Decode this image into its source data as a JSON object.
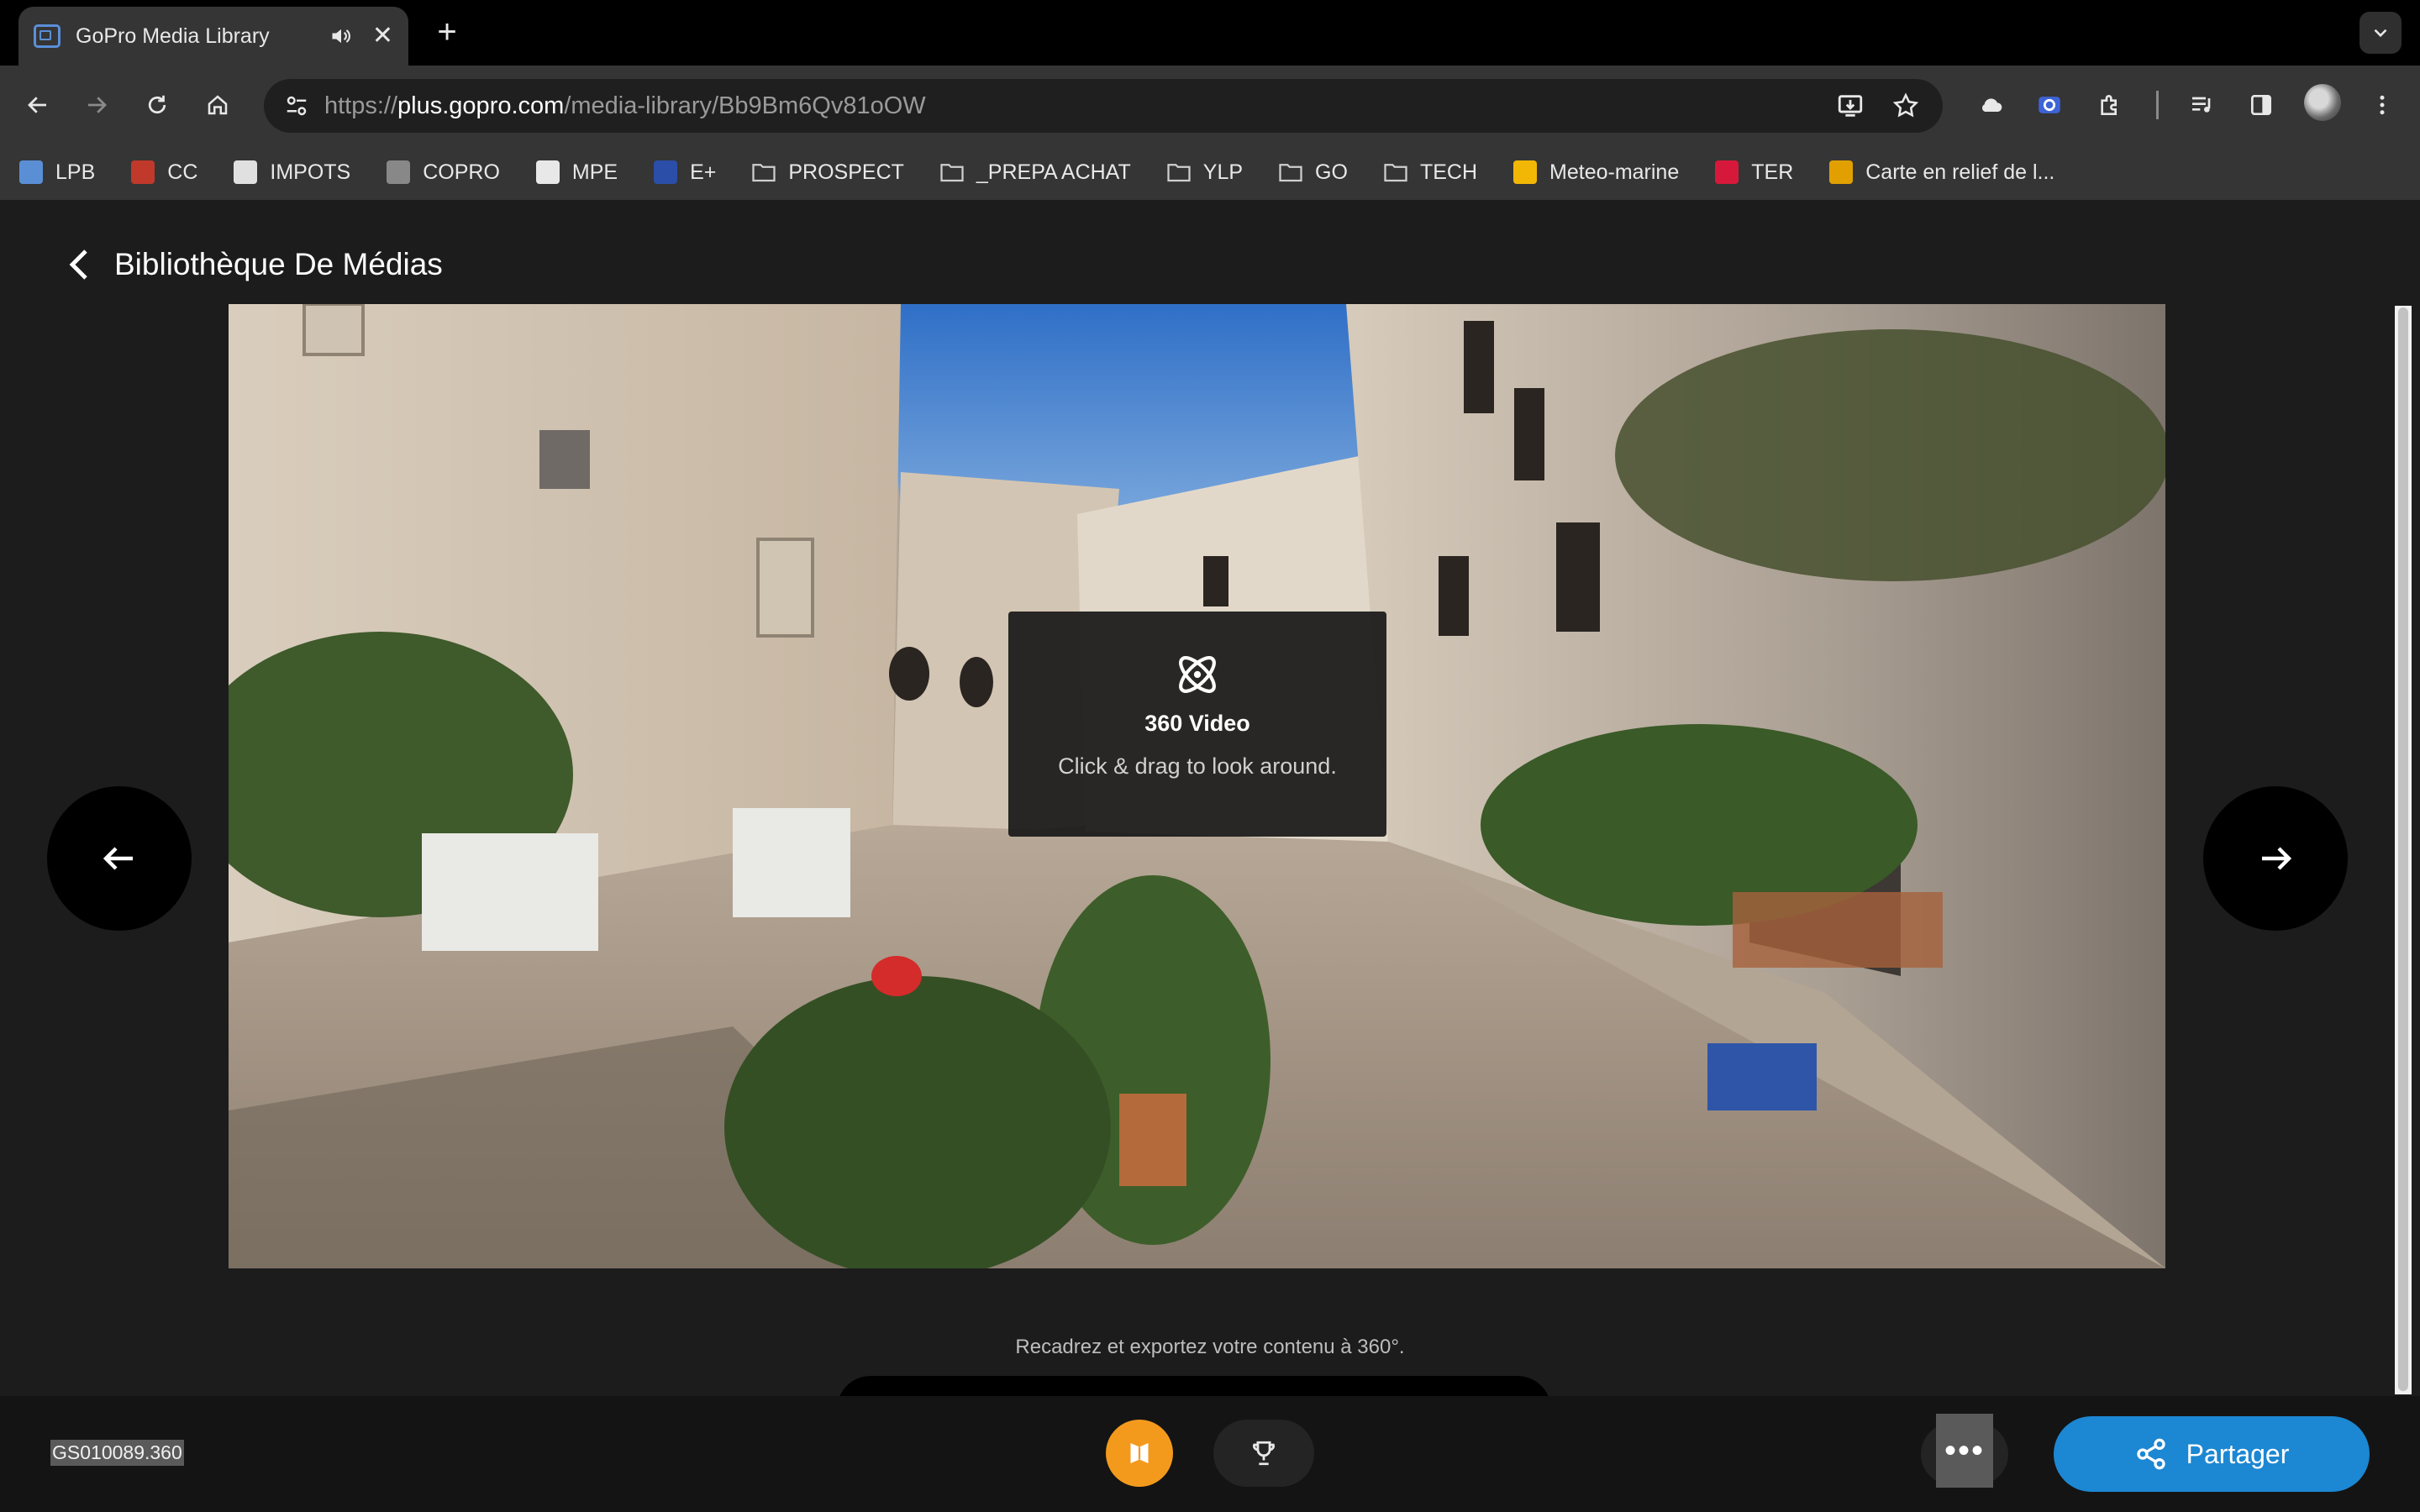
{
  "browser": {
    "tab_title": "GoPro Media Library",
    "tab_close": "✕",
    "new_tab": "+",
    "url_prefix": "https://",
    "url_host": "plus.gopro.com",
    "url_path": "/media-library/Bb9Bm6Qv81oOW"
  },
  "bookmarks": [
    {
      "label": "LPB",
      "icon": "lpb-icon",
      "color": "#5a8fd6"
    },
    {
      "label": "CC",
      "icon": "cc-icon",
      "color": "#c0392b"
    },
    {
      "label": "IMPOTS",
      "icon": "impots-icon",
      "color": "#e0e0e0"
    },
    {
      "label": "COPRO",
      "icon": "copro-icon",
      "color": "#888888"
    },
    {
      "label": "MPE",
      "icon": "mpe-icon",
      "color": "#e8e8e8"
    },
    {
      "label": "E+",
      "icon": "eu-icon",
      "color": "#2b4ea8"
    },
    {
      "label": "PROSPECT",
      "icon": "folder-icon",
      "color": "#cfcfcf"
    },
    {
      "label": "_PREPA ACHAT",
      "icon": "folder-icon",
      "color": "#cfcfcf"
    },
    {
      "label": "YLP",
      "icon": "folder-icon",
      "color": "#cfcfcf"
    },
    {
      "label": "GO",
      "icon": "folder-icon",
      "color": "#cfcfcf"
    },
    {
      "label": "TECH",
      "icon": "folder-icon",
      "color": "#cfcfcf"
    },
    {
      "label": "Meteo-marine",
      "icon": "meteo-icon",
      "color": "#f2b705"
    },
    {
      "label": "TER",
      "icon": "sncf-icon",
      "color": "#d6193a"
    },
    {
      "label": "Carte en relief de l...",
      "icon": "fnac-icon",
      "color": "#e1a000"
    }
  ],
  "page": {
    "back_label": "Bibliothèque De Médias",
    "overlay_title": "360 Video",
    "overlay_subtitle": "Click & drag to look around.",
    "hint": "Recadrez et exportez votre contenu à 360°."
  },
  "bottom": {
    "filename": "GS010089.360",
    "more_label": "•••",
    "share_label": "Partager"
  },
  "colors": {
    "accent_orange": "#f39a1d",
    "share_blue": "#1c87d2",
    "chrome_bg": "#353535",
    "page_bg": "#1c1c1c"
  }
}
